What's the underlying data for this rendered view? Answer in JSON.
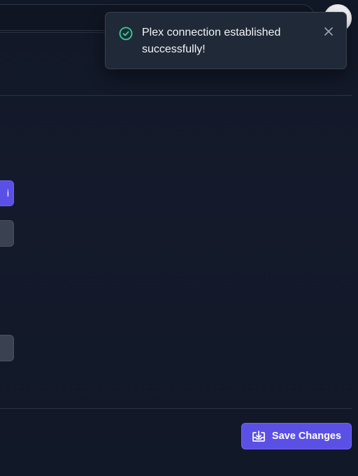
{
  "toast": {
    "message": "Plex connection established successfully!",
    "status_color": "#34d399"
  },
  "footer": {
    "save_label": "Save Changes"
  },
  "colors": {
    "accent": "#5b50e6",
    "background": "#111827",
    "toast_background": "#1f2937"
  },
  "icons": {
    "toast_status": "check-circle-icon",
    "toast_close": "close-icon",
    "save": "download-tray-icon"
  }
}
